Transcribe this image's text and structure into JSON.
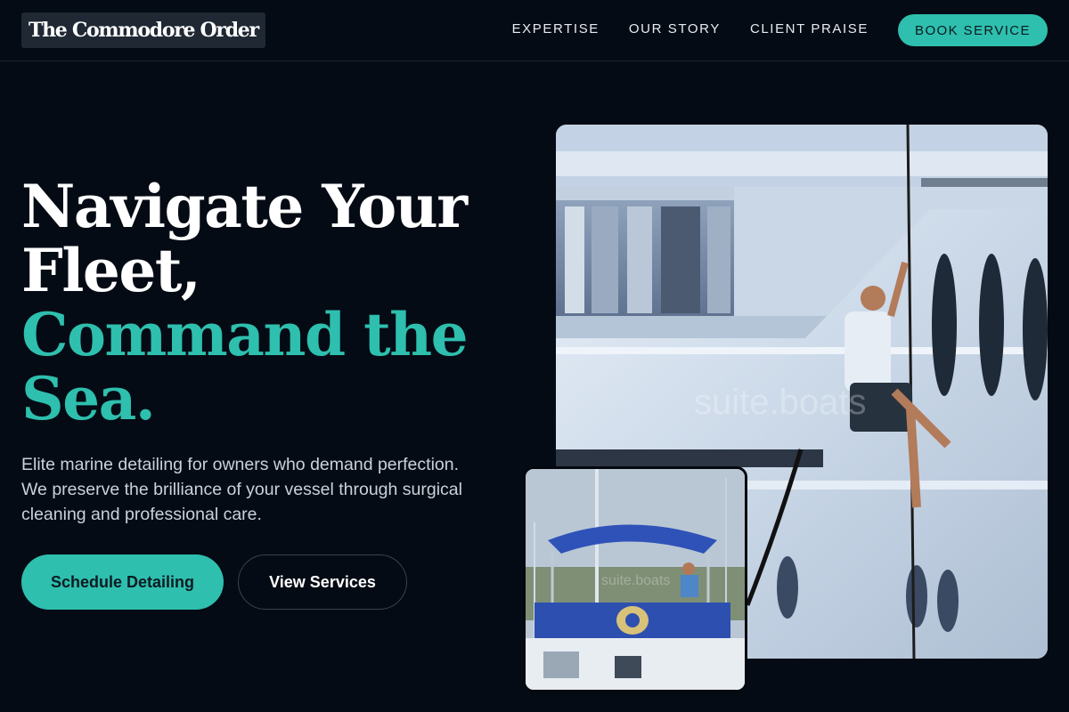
{
  "nav": {
    "logo": "The Commodore Order",
    "links": [
      "EXPERTISE",
      "OUR STORY",
      "CLIENT PRAISE"
    ],
    "cta": "BOOK SERVICE"
  },
  "hero": {
    "headline_line1": "Navigate Your",
    "headline_line2": "Fleet,",
    "headline_line3": "Command the",
    "headline_line4": "Sea.",
    "subtext": "Elite marine detailing for owners who demand perfection. We preserve the brilliance of your vessel through surgical cleaning and professional care.",
    "primary_cta": "Schedule Detailing",
    "secondary_cta": "View Services"
  },
  "images": {
    "main_watermark": "suite.boats",
    "inset_watermark": "suite.boats"
  },
  "colors": {
    "background": "#050b14",
    "accent": "#2ebfae",
    "text": "#ffffff"
  }
}
